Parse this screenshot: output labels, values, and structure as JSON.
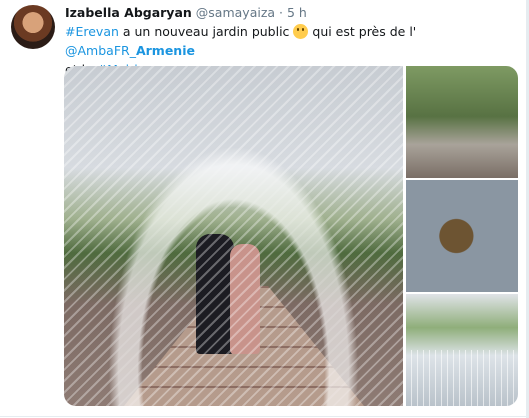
{
  "tweet": {
    "author_name": "Izabella Abgaryan",
    "handle": "@samayaiza",
    "separator": "·",
    "time": "5 h",
    "text": {
      "hashtag_city": "#Erevan",
      "part1": " a un nouveau jardin public ",
      "emoji": "smiling-face",
      "part2": " qui est près de l' ",
      "mention_prefix": "@AmbaFR_",
      "mention_bold": "Armenie",
      "part3": "et la ",
      "hashtag_mairie": "#Mairie"
    },
    "media": {
      "photos": [
        {
          "id": "main",
          "alt": ""
        },
        {
          "id": "statue-fountain",
          "alt": ""
        },
        {
          "id": "statue-child",
          "alt": ""
        },
        {
          "id": "fountain-jets",
          "alt": ""
        }
      ]
    }
  },
  "colors": {
    "link": "#1b95e0",
    "text": "#14171a",
    "secondary": "#657786",
    "divider": "#e6ecf0"
  }
}
